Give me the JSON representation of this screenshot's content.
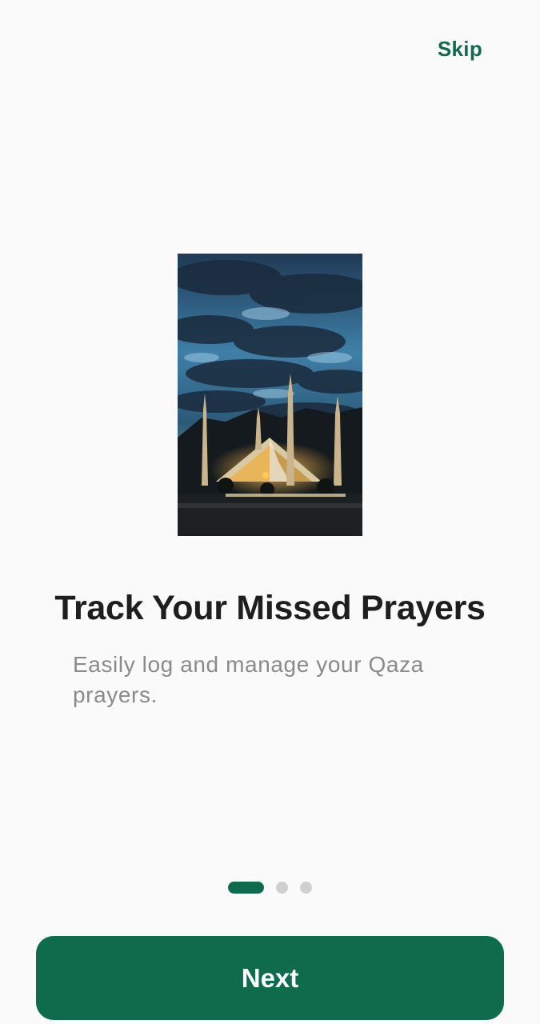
{
  "onboarding": {
    "skip_label": "Skip",
    "title": "Track Your Missed Prayers",
    "description": "Easily log and manage your Qaza prayers.",
    "next_label": "Next",
    "page_indicator": {
      "current": 1,
      "total": 3
    }
  },
  "hero_image": {
    "icon": "mosque-photo"
  },
  "colors": {
    "accent": "#0e6b4c",
    "background": "#fafafa",
    "title": "#1e1e1e",
    "subtitle": "#8a8a8a",
    "dot_inactive": "#cfcfcf"
  }
}
